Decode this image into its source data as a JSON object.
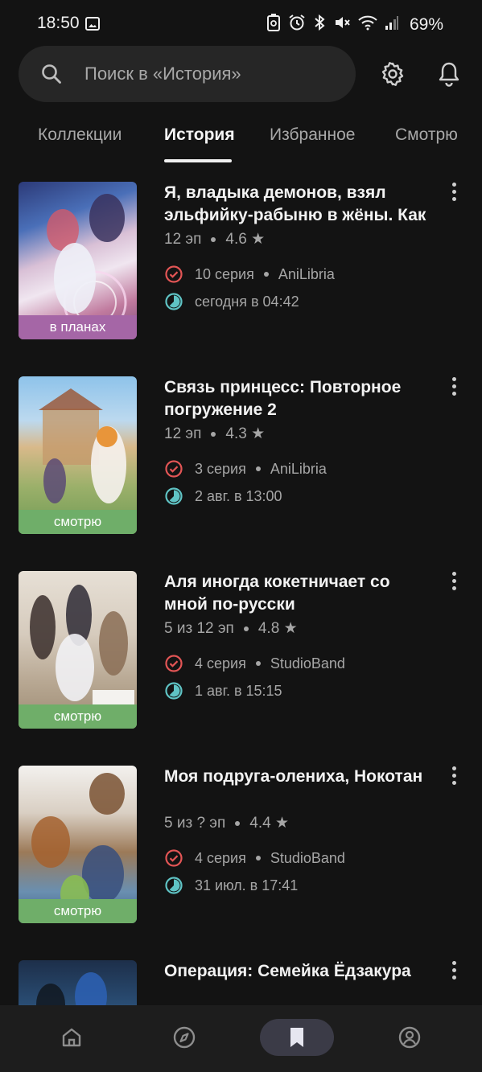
{
  "status": {
    "time": "18:50",
    "battery": "69%"
  },
  "search": {
    "placeholder": "Поиск в «История»"
  },
  "tabs": [
    {
      "label": "Коллекции",
      "active": false
    },
    {
      "label": "История",
      "active": true
    },
    {
      "label": "Избранное",
      "active": false
    },
    {
      "label": "Смотрю",
      "active": false
    }
  ],
  "items": [
    {
      "title": "Я, владыка демонов, взял эльфийку-рабыню в жёны. Как же мне её любить?",
      "episodes": "12 эп",
      "rating": "4.6",
      "status": "в планах",
      "status_color": "#a566a6",
      "episode": "10 серия",
      "team": "AniLibria",
      "time": "сегодня в 04:42"
    },
    {
      "title": "Связь принцесс: Повторное погружение 2",
      "episodes": "12 эп",
      "rating": "4.3",
      "status": "смотрю",
      "status_color": "#6fae69",
      "episode": "3 серия",
      "team": "AniLibria",
      "time": "2 авг. в 13:00"
    },
    {
      "title": "Аля иногда кокетничает со мной по-русски",
      "episodes": "5 из 12 эп",
      "rating": "4.8",
      "status": "смотрю",
      "status_color": "#6fae69",
      "episode": "4 серия",
      "team": "StudioBand",
      "time": "1 авг. в 15:15"
    },
    {
      "title": "Моя подруга-олениха, Нокотан",
      "episodes": "5 из ? эп",
      "rating": "4.4",
      "status": "смотрю",
      "status_color": "#6fae69",
      "episode": "4 серия",
      "team": "StudioBand",
      "time": "31 июл. в 17:41"
    },
    {
      "title": "Операция: Семейка Ёдзакура",
      "episodes": "",
      "rating": "",
      "status": "",
      "status_color": "#6fae69",
      "episode": "",
      "team": "",
      "time": ""
    }
  ],
  "colors": {
    "background": "#131313",
    "check_icon": "#e25555",
    "clock_icon": "#5fc3c4",
    "nav_active": "#3b3b47"
  },
  "nav": [
    {
      "icon": "home-icon"
    },
    {
      "icon": "compass-icon"
    },
    {
      "icon": "bookmark-icon",
      "active": true
    },
    {
      "icon": "profile-icon"
    }
  ]
}
